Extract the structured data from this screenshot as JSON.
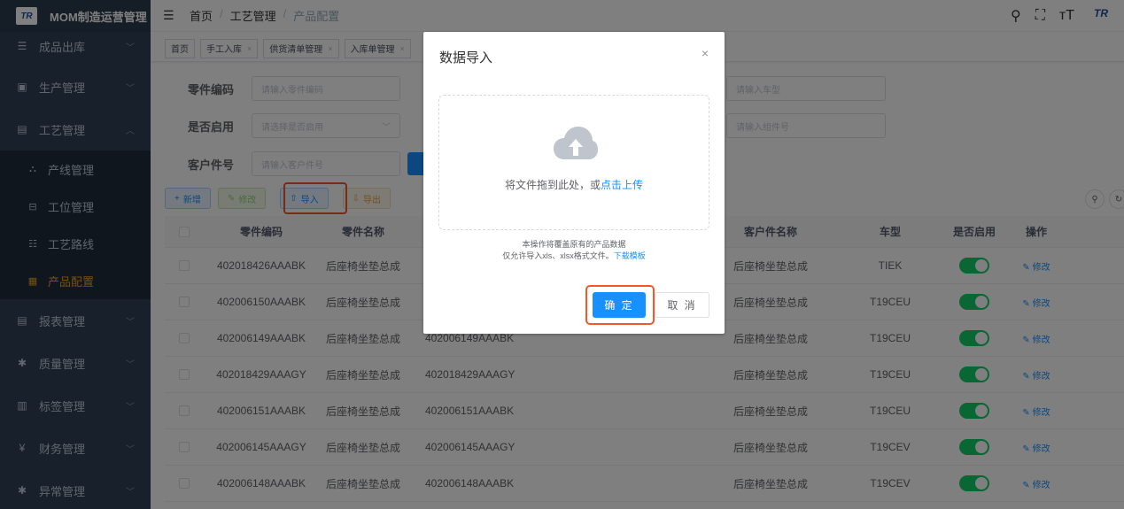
{
  "app": {
    "title": "MOM制造运营管理",
    "logo_text": "TR"
  },
  "colors": {
    "primary": "#1890ff",
    "sidebar_bg": "#304156",
    "active_menu": "#f0a020",
    "highlight": "#f0592a",
    "switch_on": "#13ce66"
  },
  "sidebar": {
    "items": [
      {
        "label": "成品出库",
        "icon": "list-icon"
      },
      {
        "label": "生产管理",
        "icon": "monitor-icon"
      },
      {
        "label": "工艺管理",
        "icon": "process-icon"
      },
      {
        "label": "报表管理",
        "icon": "report-icon"
      },
      {
        "label": "质量管理",
        "icon": "bug-icon"
      },
      {
        "label": "标签管理",
        "icon": "tag-icon"
      },
      {
        "label": "财务管理",
        "icon": "yen-icon"
      },
      {
        "label": "异常管理",
        "icon": "bug-icon"
      }
    ],
    "subitems": [
      {
        "label": "产线管理",
        "icon": "tree-icon"
      },
      {
        "label": "工位管理",
        "icon": "station-icon"
      },
      {
        "label": "工艺路线",
        "icon": "route-icon"
      },
      {
        "label": "产品配置",
        "icon": "config-icon"
      }
    ]
  },
  "breadcrumb": [
    "首页",
    "工艺管理",
    "产品配置"
  ],
  "tags": [
    "首页",
    "手工入库",
    "供货清单管理",
    "入库单管理"
  ],
  "search": {
    "part_code_label": "零件编码",
    "part_code_placeholder": "请输入零件编码",
    "enabled_label": "是否启用",
    "enabled_placeholder": "请选择是否启用",
    "customer_no_label": "客户件号",
    "customer_no_placeholder": "请输入客户件号",
    "model_placeholder": "请输入车型",
    "group_placeholder": "请输入组件号"
  },
  "toolbar": {
    "add": "新增",
    "edit": "修改",
    "import": "导入",
    "export": "导出"
  },
  "table": {
    "headers": {
      "part_code": "零件编码",
      "part_name": "零件名称",
      "customer_name": "客户件名称",
      "model": "车型",
      "enabled": "是否启用",
      "op": "操作"
    },
    "op_label": "修改",
    "rows": [
      {
        "code": "402018426AAABK",
        "name": "后座椅坐垫总成",
        "ccode": "",
        "cname": "后座椅坐垫总成",
        "model": "TIEK"
      },
      {
        "code": "402006150AAABK",
        "name": "后座椅坐垫总成",
        "ccode": "",
        "cname": "后座椅坐垫总成",
        "model": "T19CEU"
      },
      {
        "code": "402006149AAABK",
        "name": "后座椅坐垫总成",
        "ccode": "402006149AAABK",
        "cname": "后座椅坐垫总成",
        "model": "T19CEU"
      },
      {
        "code": "402018429AAAGY",
        "name": "后座椅坐垫总成",
        "ccode": "402018429AAAGY",
        "cname": "后座椅坐垫总成",
        "model": "T19CEU"
      },
      {
        "code": "402006151AAABK",
        "name": "后座椅坐垫总成",
        "ccode": "402006151AAABK",
        "cname": "后座椅坐垫总成",
        "model": "T19CEU"
      },
      {
        "code": "402006145AAAGY",
        "name": "后座椅坐垫总成",
        "ccode": "402006145AAAGY",
        "cname": "后座椅坐垫总成",
        "model": "T19CEV"
      },
      {
        "code": "402006148AAABK",
        "name": "后座椅坐垫总成",
        "ccode": "402006148AAABK",
        "cname": "后座椅坐垫总成",
        "model": "T19CEV"
      }
    ]
  },
  "dialog": {
    "title": "数据导入",
    "upload_text": "将文件拖到此处，或",
    "upload_link": "点击上传",
    "tip_line1": "本操作将覆盖原有的产品数据",
    "tip_line2": "仅允许导入xls、xlsx格式文件。",
    "tip_link": "下载模板",
    "confirm": "确 定",
    "cancel": "取 消"
  }
}
